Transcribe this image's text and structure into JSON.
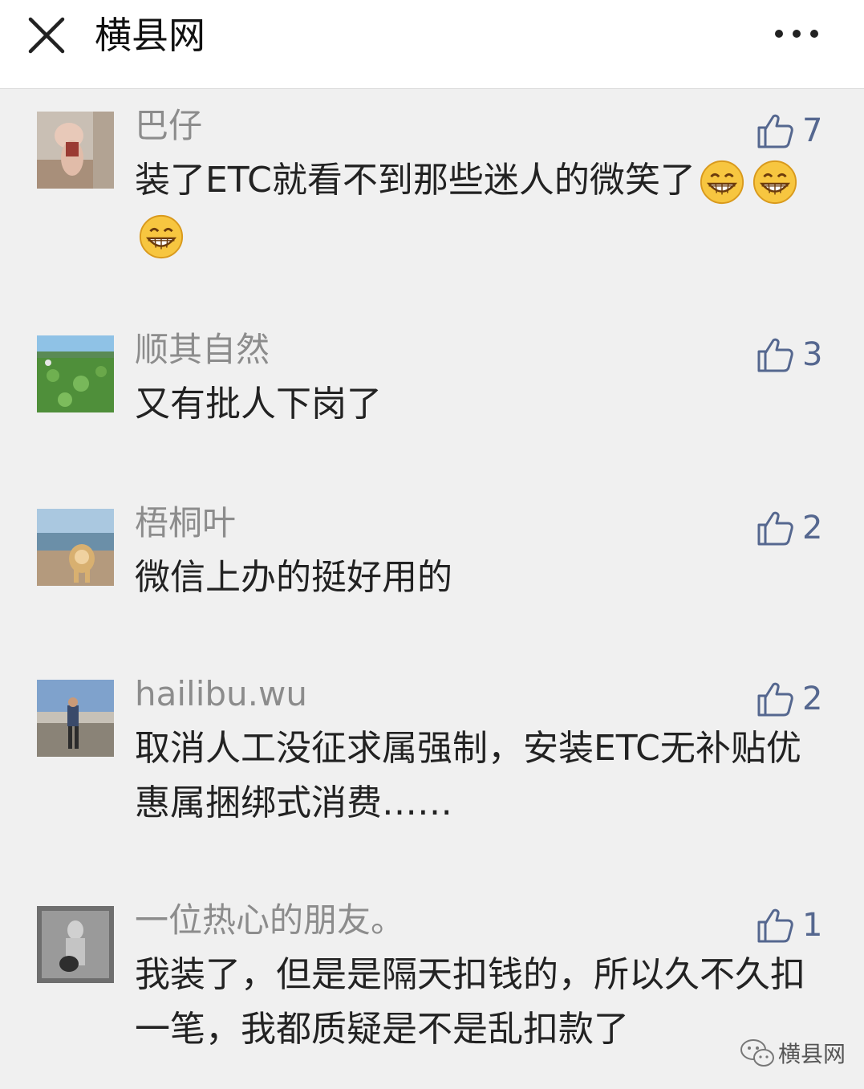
{
  "header": {
    "title": "横县网",
    "close_icon": "close-icon",
    "more_icon": "more-horizontal-icon"
  },
  "colors": {
    "like_blue": "#55678f",
    "nickname_gray": "#8c8c8c",
    "background": "#f0f0f0"
  },
  "comments": [
    {
      "nickname": "巴仔",
      "likes": "7",
      "text": "装了ETC就看不到那些迷人的微笑了",
      "emoji": "grin-emoji",
      "emoji_count": 3
    },
    {
      "nickname": "顺其自然",
      "likes": "3",
      "text": "又有批人下岗了"
    },
    {
      "nickname": "梧桐叶",
      "likes": "2",
      "text": "微信上办的挺好用的"
    },
    {
      "nickname": "hailibu.wu",
      "likes": "2",
      "text": "取消人工没征求属强制，安装ETC无补贴优惠属捆绑式消费……"
    },
    {
      "nickname": "一位热心的朋友。",
      "likes": "1",
      "text": "我装了，但是是隔天扣钱的，所以久不久扣一笔，我都质疑是不是乱扣款了"
    }
  ],
  "watermark": {
    "text": "横县网",
    "icon": "wechat-icon"
  }
}
